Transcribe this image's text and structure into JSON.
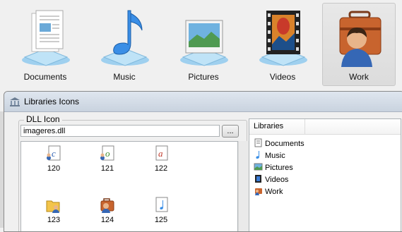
{
  "libraries": [
    {
      "label": "Documents",
      "icon": "documents-icon"
    },
    {
      "label": "Music",
      "icon": "music-note-icon"
    },
    {
      "label": "Pictures",
      "icon": "pictures-icon"
    },
    {
      "label": "Videos",
      "icon": "film-strip-icon"
    },
    {
      "label": "Work",
      "icon": "briefcase-user-icon",
      "selected": true
    }
  ],
  "window": {
    "title": "Libraries Icons",
    "title_icon": "library-columns-icon"
  },
  "dll_group": {
    "label": "DLL Icon",
    "path_value": "imageres.dll",
    "browse_label": "...",
    "icons": [
      {
        "number": "120",
        "icon": "text-document-c-icon"
      },
      {
        "number": "121",
        "icon": "text-document-o-icon"
      },
      {
        "number": "122",
        "icon": "text-document-a-icon"
      },
      {
        "number": "123",
        "icon": "folder-user-icon"
      },
      {
        "number": "124",
        "icon": "briefcase-user-icon"
      },
      {
        "number": "125",
        "icon": "music-document-icon"
      }
    ]
  },
  "library_list": {
    "header": "Libraries",
    "items": [
      {
        "label": "Documents",
        "icon": "documents-icon"
      },
      {
        "label": "Music",
        "icon": "music-note-icon"
      },
      {
        "label": "Pictures",
        "icon": "pictures-icon"
      },
      {
        "label": "Videos",
        "icon": "film-strip-icon"
      },
      {
        "label": "Work",
        "icon": "briefcase-user-icon"
      }
    ]
  },
  "colors": {
    "accent_blue": "#3a8ee6",
    "selection_bg": "#dcdcdc",
    "title_bar": "#c9d3df"
  }
}
